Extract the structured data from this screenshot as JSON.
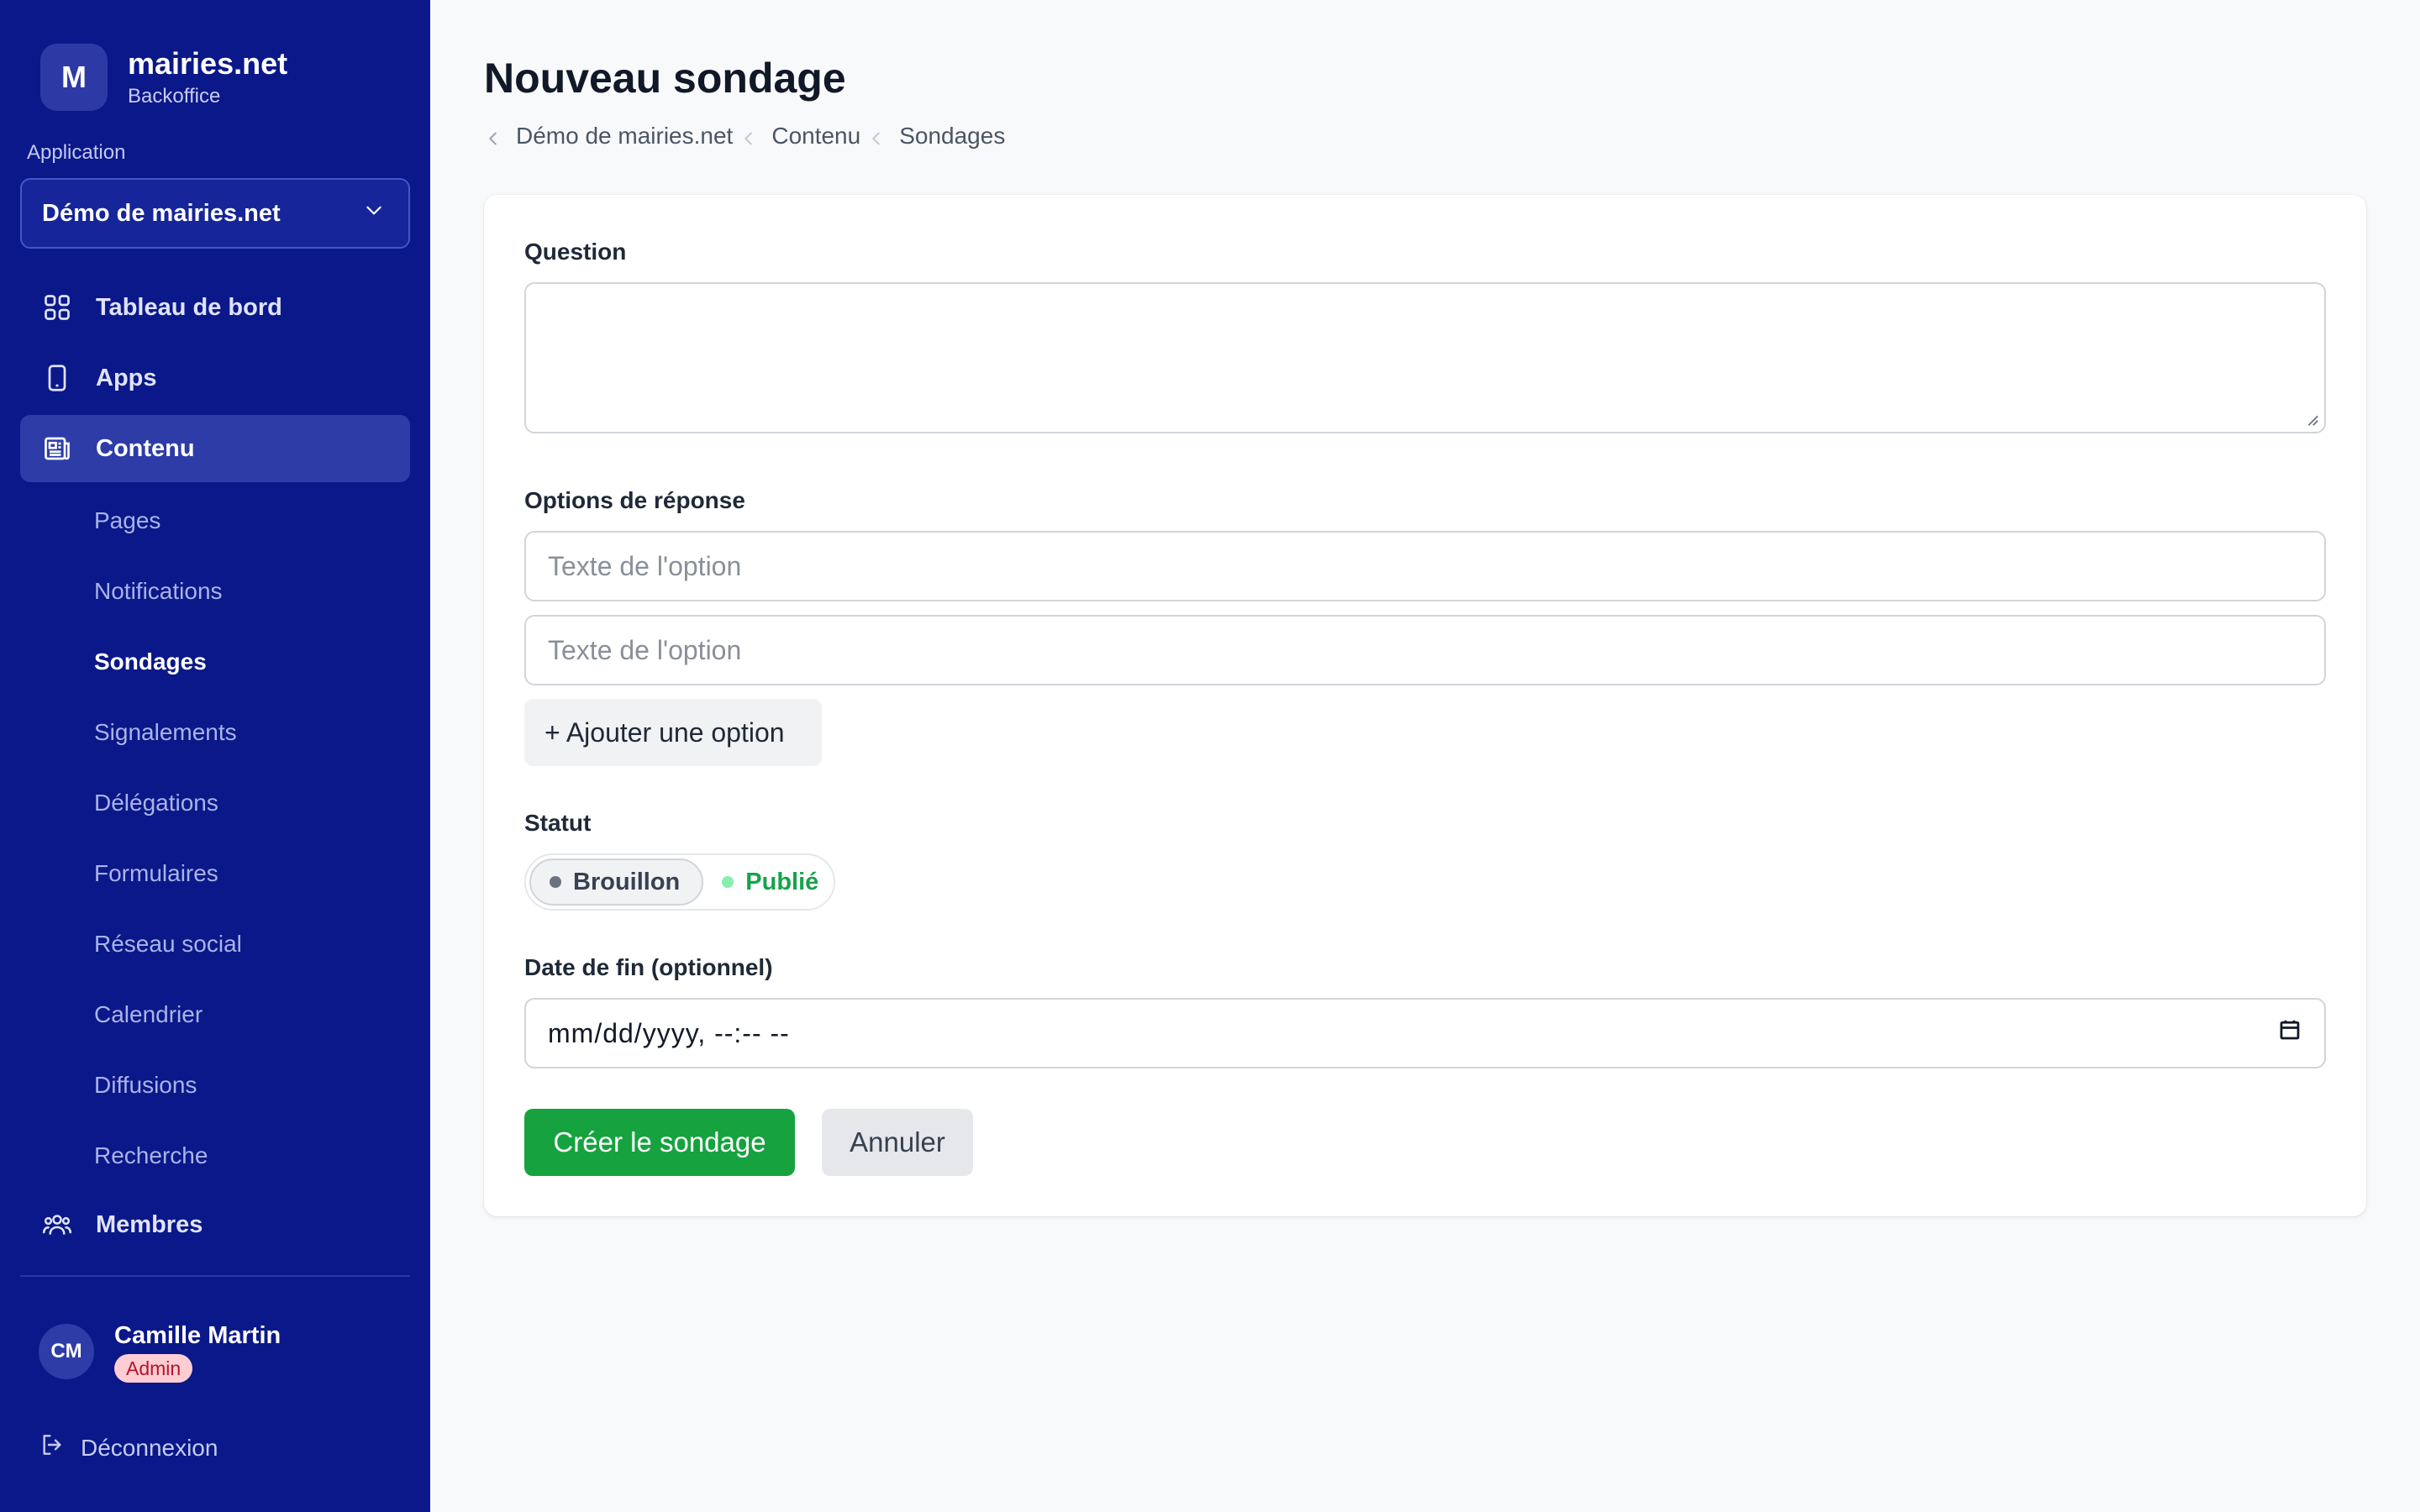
{
  "sidebar": {
    "logo_letter": "M",
    "brand_name": "mairies.net",
    "brand_sub": "Backoffice",
    "app_label": "Application",
    "app_selected": "Démo de mairies.net",
    "nav": {
      "dashboard": "Tableau de bord",
      "apps": "Apps",
      "content": "Contenu",
      "members": "Membres"
    },
    "sub": [
      "Pages",
      "Notifications",
      "Sondages",
      "Signalements",
      "Délégations",
      "Formulaires",
      "Réseau social",
      "Calendrier",
      "Diffusions",
      "Recherche"
    ],
    "user": {
      "initials": "CM",
      "name": "Camille Martin",
      "role": "Admin"
    },
    "logout": "Déconnexion"
  },
  "main": {
    "title": "Nouveau sondage",
    "breadcrumb": [
      "Démo de mairies.net",
      "Contenu",
      "Sondages"
    ],
    "form": {
      "question_label": "Question",
      "question_value": "",
      "options_label": "Options de réponse",
      "option_placeholder_1": "Texte de l'option",
      "option_placeholder_2": "Texte de l'option",
      "add_option": "+ Ajouter une option",
      "status_label": "Statut",
      "status_options": [
        "Brouillon",
        "Publié"
      ],
      "status_selected": "Brouillon",
      "end_date_label": "Date de fin (optionnel)",
      "end_date_value": "mm/dd/yyyy, --:-- --",
      "submit": "Créer le sondage",
      "cancel": "Annuler"
    }
  },
  "colors": {
    "sidebar_bg": "#0b1889",
    "sidebar_active": "#2e3ca8",
    "primary_button": "#16a33f",
    "published_green": "#16a34a",
    "admin_badge_bg": "#fecdd3",
    "admin_badge_text": "#b4132c"
  }
}
